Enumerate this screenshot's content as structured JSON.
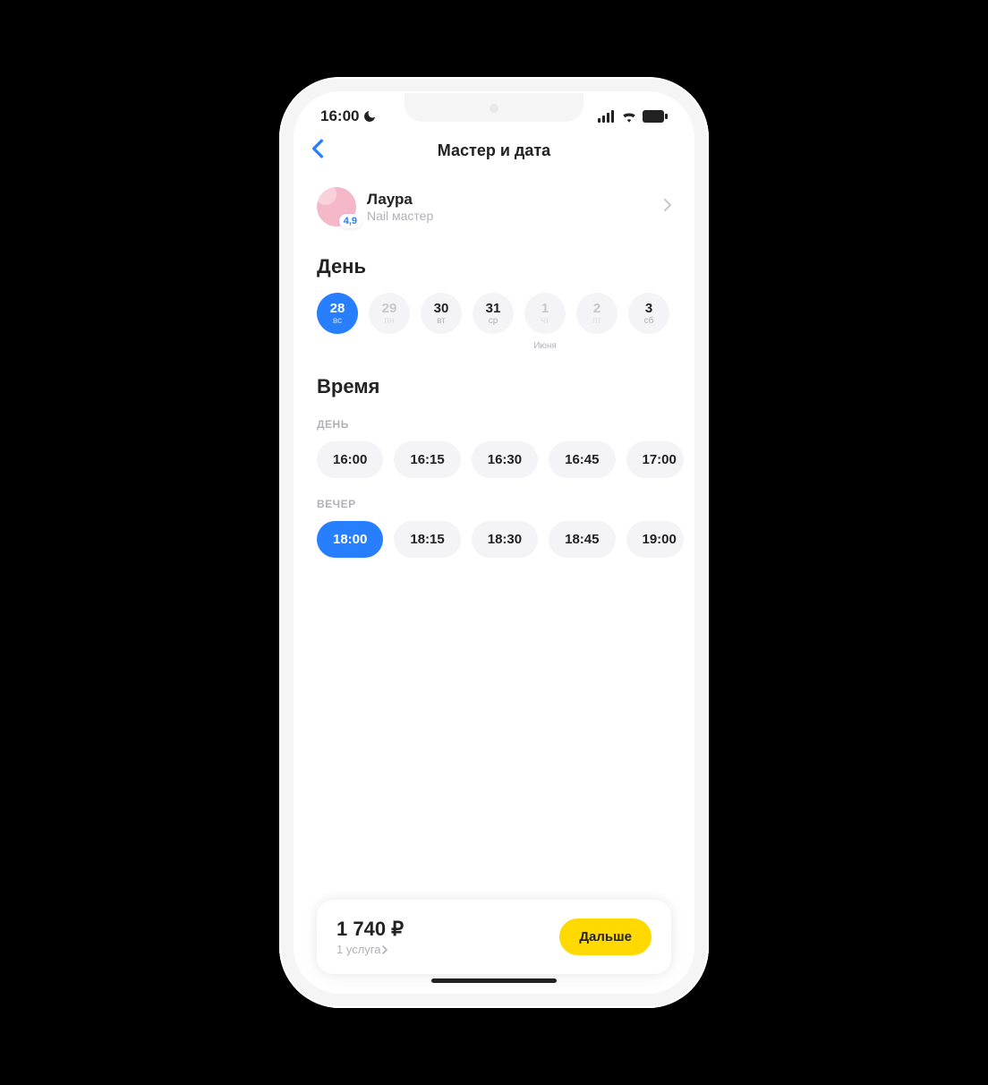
{
  "status": {
    "time": "16:00"
  },
  "nav": {
    "title": "Мастер и дата"
  },
  "master": {
    "name": "Лаура",
    "role": "Nail мастер",
    "rating": "4,9"
  },
  "day_section": {
    "title": "День"
  },
  "days": [
    {
      "num": "28",
      "wd": "вс",
      "month": "",
      "state": "selected"
    },
    {
      "num": "29",
      "wd": "пн",
      "month": "",
      "state": "disabled"
    },
    {
      "num": "30",
      "wd": "вт",
      "month": "",
      "state": ""
    },
    {
      "num": "31",
      "wd": "ср",
      "month": "",
      "state": ""
    },
    {
      "num": "1",
      "wd": "чт",
      "month": "Июня",
      "state": "disabled"
    },
    {
      "num": "2",
      "wd": "пт",
      "month": "",
      "state": "disabled"
    },
    {
      "num": "3",
      "wd": "сб",
      "month": "",
      "state": ""
    }
  ],
  "time_section": {
    "title": "Время",
    "day_label": "ДЕНЬ",
    "evening_label": "ВЕЧЕР"
  },
  "times_day": [
    {
      "t": "16:00"
    },
    {
      "t": "16:15"
    },
    {
      "t": "16:30"
    },
    {
      "t": "16:45"
    },
    {
      "t": "17:00"
    }
  ],
  "times_eve": [
    {
      "t": "18:00",
      "sel": true
    },
    {
      "t": "18:15"
    },
    {
      "t": "18:30"
    },
    {
      "t": "18:45"
    },
    {
      "t": "19:00"
    }
  ],
  "footer": {
    "price": "1 740 ₽",
    "services": "1 услуга",
    "next": "Дальше"
  }
}
